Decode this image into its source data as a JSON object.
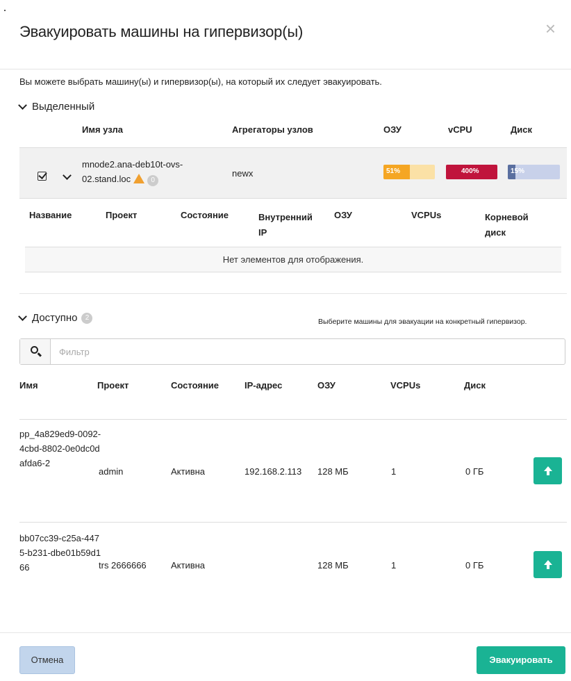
{
  "modal": {
    "title": "Эвакуировать машины на гипервизор(ы)",
    "close": "×",
    "intro": "Вы можете выбрать машину(ы) и гипервизор(ы), на который их следует эвакуировать."
  },
  "selected": {
    "label": "Выделенный",
    "headers": {
      "node_name": "Имя узла",
      "aggregates": "Агрегаторы узлов",
      "ram": "ОЗУ",
      "vcpu": "vCPU",
      "disk": "Диск"
    },
    "node": {
      "name_line1": "mnode2.ana-deb10t-ovs-",
      "name_line2": "02.stand.loc",
      "badge": "0",
      "aggregate": "newx",
      "ram_label": "51%",
      "ram_percent": 51,
      "vcpu_label": "400%",
      "vcpu_percent": 100,
      "disk_label": "15%",
      "disk_percent": 15
    },
    "inner_headers": {
      "name": "Название",
      "project": "Проект",
      "status": "Состояние",
      "internal_ip_1": "Внутренний",
      "internal_ip_2": "IP",
      "ram": "ОЗУ",
      "vcpus": "VCPUs",
      "root_disk_1": "Корневой",
      "root_disk_2": "диск"
    },
    "empty_text": "Нет элементов для отображения."
  },
  "available": {
    "label": "Доступно",
    "badge": "2",
    "hint": "Выберите машины для эвакуации на конкретный гипервизор.",
    "filter_placeholder": "Фильтр",
    "headers": {
      "name": "Имя",
      "project": "Проект",
      "status": "Состояние",
      "ip": "IP-адрес",
      "ram": "ОЗУ",
      "vcpus": "VCPUs",
      "disk": "Диск"
    },
    "rows": [
      {
        "name": "pp_4a829ed9-0092-4cbd-8802-0e0dc0dafda6-2",
        "project": "admin",
        "status": "Активна",
        "ip": "192.168.2.113",
        "ram": "128 МБ",
        "vcpus": "1",
        "disk": "0 ГБ"
      },
      {
        "name": "bb07cc39-c25a-4475-b231-dbe01b59d166",
        "project": "trs 2666666",
        "status": "Активна",
        "ip": "",
        "ram": "128 МБ",
        "vcpus": "1",
        "disk": "0 ГБ"
      }
    ]
  },
  "footer": {
    "cancel": "Отмена",
    "evacuate": "Эвакуировать"
  },
  "colors": {
    "accent": "#1ab394",
    "ram_bar": "#f5a623",
    "vcpu_bar": "#c0143c",
    "disk_bar": "#5a6fa0",
    "cancel_bg": "#c2d5ec"
  },
  "icons": {
    "close": "close-icon",
    "warning": "warning-icon",
    "search": "search-icon",
    "move": "arrow-up-icon",
    "check": "checkbox-icon"
  }
}
